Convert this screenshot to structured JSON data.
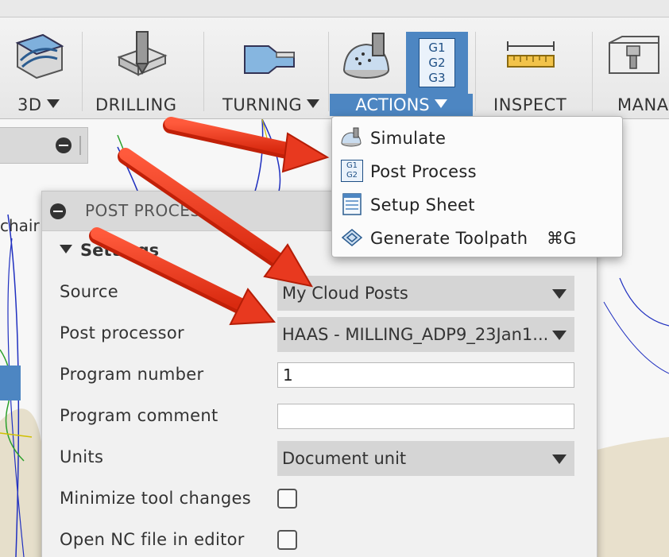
{
  "toolbar": {
    "tools": [
      {
        "label": "3D",
        "has_caret": true,
        "icon": "3d-adaptive-icon"
      },
      {
        "label": "DRILLING",
        "has_caret": false,
        "icon": "drill-icon"
      },
      {
        "label": "TURNING",
        "has_caret": true,
        "icon": "turning-icon"
      },
      {
        "label": "ACTIONS",
        "has_caret": true,
        "icon": "simulate-icon"
      },
      {
        "label": "INSPECT",
        "has_caret": false,
        "icon": "ruler-icon"
      },
      {
        "label": "MANA",
        "has_caret": false,
        "icon": "tool-library-icon"
      }
    ],
    "g_code_button": {
      "lines": [
        "G1",
        "G2",
        "G3"
      ]
    }
  },
  "browser": {
    "partial_label": "chair"
  },
  "actions_menu": {
    "items": [
      {
        "label": "Simulate",
        "shortcut": "",
        "icon": "simulate-icon"
      },
      {
        "label": "Post Process",
        "shortcut": "",
        "icon": "post-process-icon"
      },
      {
        "label": "Setup Sheet",
        "shortcut": "",
        "icon": "setup-sheet-icon"
      },
      {
        "label": "Generate Toolpath",
        "shortcut": "⌘G",
        "icon": "generate-toolpath-icon"
      }
    ],
    "post_icon_lines": [
      "G1",
      "G2"
    ]
  },
  "dialog": {
    "title": "POST PROCES",
    "settings_header": "Settings",
    "source_label": "Source",
    "source_value": "My Cloud Posts",
    "post_processor_label": "Post processor",
    "post_processor_value": "HAAS - MILLING_ADP9_23Jan1...",
    "program_number_label": "Program number",
    "program_number_value": "1",
    "program_comment_label": "Program comment",
    "program_comment_value": "",
    "units_label": "Units",
    "units_value": "Document unit",
    "minimize_tool_changes_label": "Minimize tool changes",
    "minimize_tool_changes_checked": false,
    "open_nc_label": "Open NC file in editor",
    "open_nc_checked": false
  },
  "colors": {
    "accent_blue": "#4d86c2",
    "arrow_red": "#e8391f",
    "toolbar_bg": "#ececec"
  }
}
